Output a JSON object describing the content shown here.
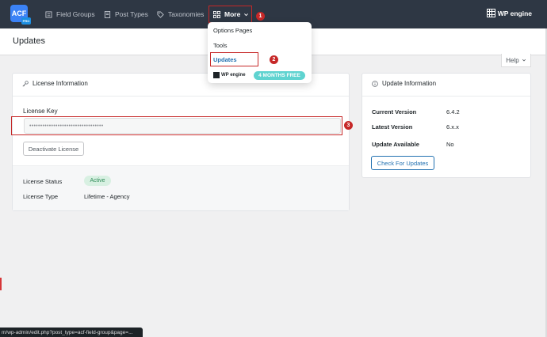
{
  "app": {
    "logo_text": "ACF",
    "logo_badge": "PRO",
    "brand_color": "#3b82f6",
    "accent_color": "#2271b1",
    "annotation_color": "#c62828"
  },
  "nav": {
    "field_groups": "Field Groups",
    "post_types": "Post Types",
    "taxonomies": "Taxonomies",
    "more": "More",
    "partner_logo": "WP engine"
  },
  "dropdown": {
    "items": [
      "Options Pages",
      "Tools",
      "Updates"
    ],
    "partner_logo": "WP engine",
    "promo": "4 MONTHS FREE"
  },
  "annotations": [
    "1",
    "2",
    "3"
  ],
  "page": {
    "title": "Updates",
    "help": "Help"
  },
  "license": {
    "title": "License Information",
    "key_label": "License Key",
    "key_value": "••••••••••••••••••••••••••••••••••",
    "deactivate_label": "Deactivate License",
    "status_label": "License Status",
    "status_value": "Active",
    "type_label": "License Type",
    "type_value": "Lifetime - Agency"
  },
  "update_info": {
    "title": "Update Information",
    "current_label": "Current Version",
    "current_value": "6.4.2",
    "latest_label": "Latest Version",
    "latest_value": "6.x.x",
    "available_label": "Update Available",
    "available_value": "No",
    "check_label": "Check For Updates"
  },
  "statusbar": {
    "url": "m/wp-admin/edit.php?post_type=acf-field-group&page=..."
  }
}
